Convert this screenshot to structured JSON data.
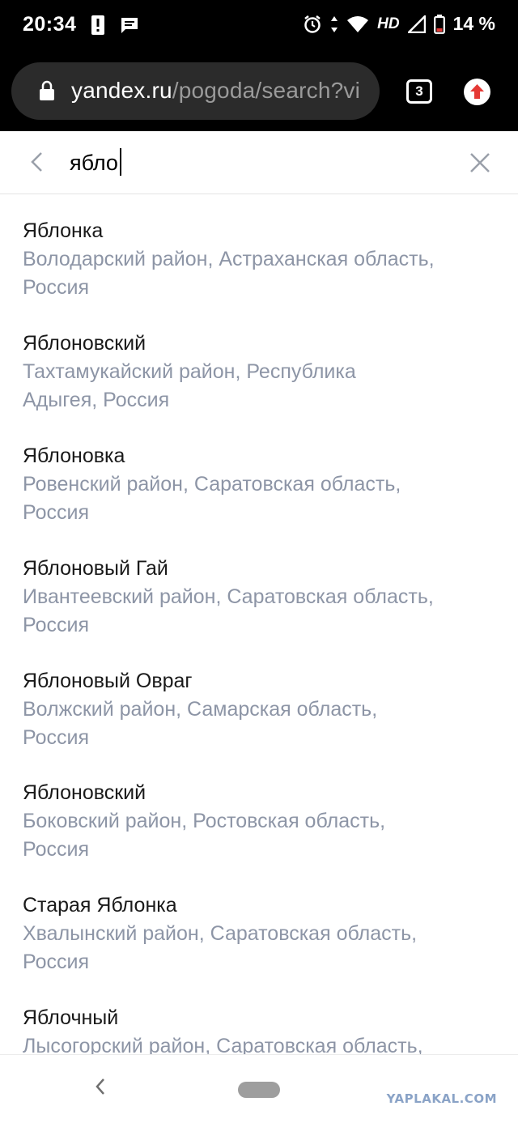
{
  "status_bar": {
    "time": "20:34",
    "battery_percent": "14 %",
    "network": "HD",
    "icons": [
      "alert-notification-icon",
      "message-notification-icon",
      "alarm-icon",
      "data-arrows-icon",
      "wifi-icon",
      "cell-signal-icon",
      "battery-icon"
    ],
    "battery_color": "#e53935"
  },
  "browser": {
    "url_host": "yandex.ru",
    "url_path": "/pogoda/search?vi",
    "tab_count": "3",
    "update_color": "#e53935"
  },
  "search": {
    "query": "ябло"
  },
  "results": [
    {
      "name": "Яблонка",
      "region_line1": "Володарский район, Астраханская область,",
      "region_line2": "Россия"
    },
    {
      "name": "Яблоновский",
      "region_line1": "Тахтамукайский район, Республика",
      "region_line2": "Адыгея, Россия"
    },
    {
      "name": "Яблоновка",
      "region_line1": "Ровенский район, Саратовская область,",
      "region_line2": "Россия"
    },
    {
      "name": "Яблоновый Гай",
      "region_line1": "Ивантеевский район, Саратовская область,",
      "region_line2": "Россия"
    },
    {
      "name": "Яблоновый Овраг",
      "region_line1": "Волжский район, Самарская область,",
      "region_line2": "Россия"
    },
    {
      "name": "Яблоновский",
      "region_line1": "Боковский район, Ростовская область,",
      "region_line2": "Россия"
    },
    {
      "name": "Старая Яблонка",
      "region_line1": "Хвалынский район, Саратовская область,",
      "region_line2": "Россия"
    },
    {
      "name": "Яблочный",
      "region_line1": "Лысогорский район, Саратовская область,",
      "region_line2": ""
    }
  ],
  "watermark": "YAPLAKAL.COM"
}
